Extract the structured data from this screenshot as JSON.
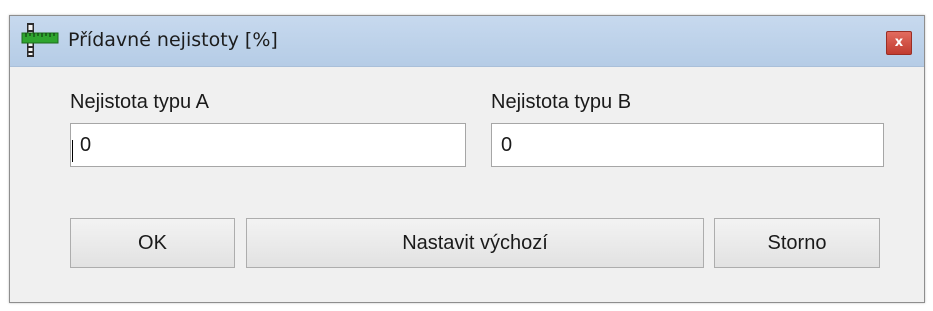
{
  "dialog": {
    "title": "Přídavné nejistoty [%]",
    "close_label": "x"
  },
  "fields": {
    "type_a": {
      "label": "Nejistota typu A",
      "value": "0"
    },
    "type_b": {
      "label": "Nejistota typu B",
      "value": "0"
    }
  },
  "buttons": {
    "ok": "OK",
    "set_default": "Nastavit výchozí",
    "cancel": "Storno"
  },
  "colors": {
    "titlebar": "#c7d9ee",
    "close_button": "#c13c30",
    "dialog_background": "#f0f0f0",
    "icon_green": "#2fa52f"
  },
  "icons": {
    "app_icon": "ruler-caliper-icon"
  }
}
